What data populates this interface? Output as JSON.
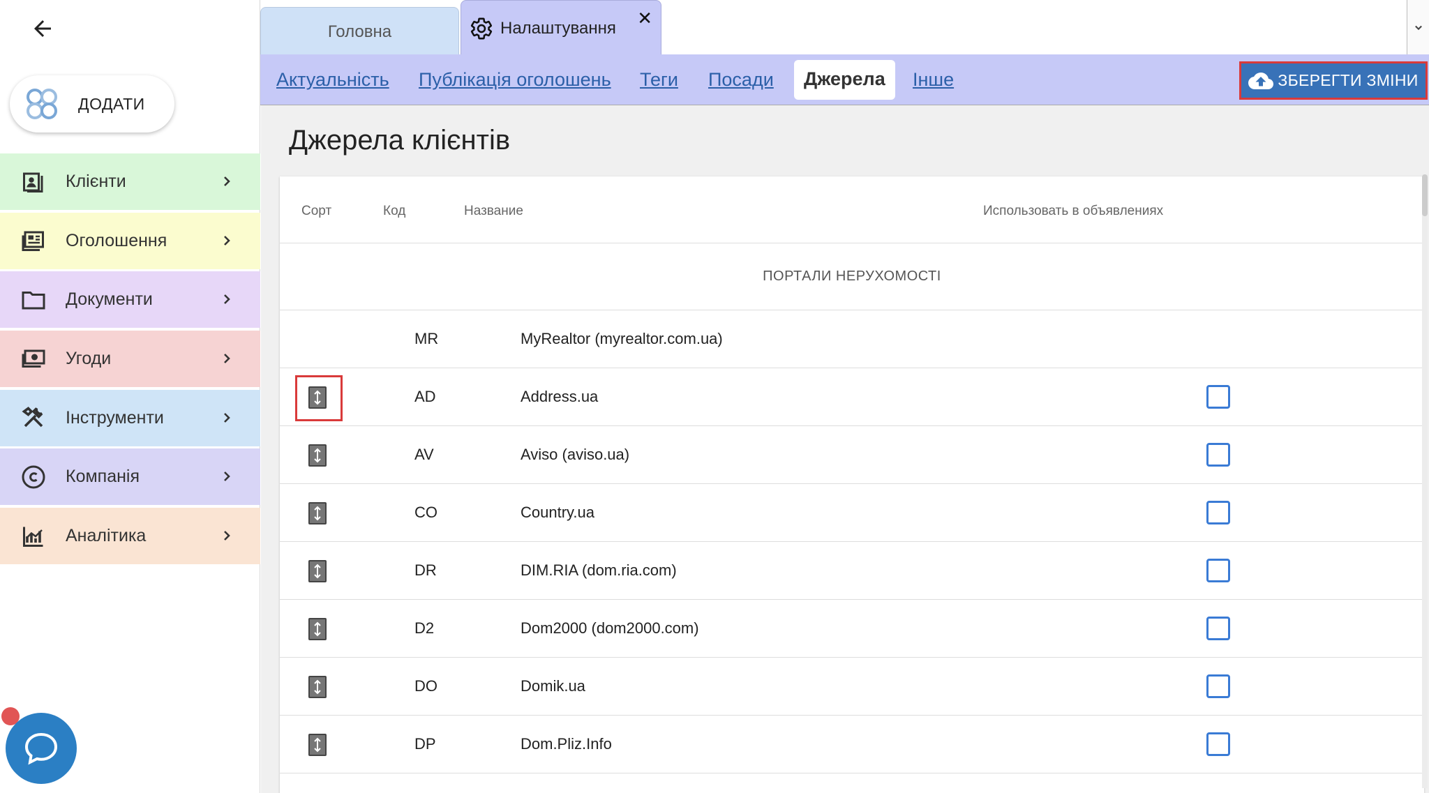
{
  "sidebar": {
    "add_label": "ДОДАТИ",
    "items": [
      {
        "label": "Клієнти",
        "icon": "contact-card-icon",
        "color": "#d9f7d9"
      },
      {
        "label": "Оголошення",
        "icon": "newspaper-icon",
        "color": "#fbfccf"
      },
      {
        "label": "Документи",
        "icon": "folder-icon",
        "color": "#e7d7f8"
      },
      {
        "label": "Угоди",
        "icon": "money-icon",
        "color": "#f6d3d3"
      },
      {
        "label": "Інструменти",
        "icon": "tools-icon",
        "color": "#cfe4f7"
      },
      {
        "label": "Компанія",
        "icon": "copyright-icon",
        "color": "#d8d5f6"
      },
      {
        "label": "Аналітика",
        "icon": "analytics-icon",
        "color": "#fae4d3"
      }
    ]
  },
  "tabs": {
    "home": "Головна",
    "settings": "Налаштування"
  },
  "subnav": {
    "items": [
      "Актуальність",
      "Публікація оголошень",
      "Теги",
      "Посади",
      "Джерела",
      "Інше"
    ],
    "active": "Джерела",
    "save_label": "ЗБЕРЕГТИ ЗМІНИ"
  },
  "page": {
    "title": "Джерела клієнтів"
  },
  "table": {
    "headers": {
      "sort": "Сорт",
      "code": "Код",
      "name": "Название",
      "use": "Использовать в объявлениях"
    },
    "group": "ПОРТАЛИ НЕРУХОМОСТІ",
    "rows": [
      {
        "code": "MR",
        "name": "MyRealtor (myrealtor.com.ua)",
        "sortable": false,
        "has_checkbox": false
      },
      {
        "code": "AD",
        "name": "Address.ua",
        "sortable": true,
        "has_checkbox": true
      },
      {
        "code": "AV",
        "name": "Aviso (aviso.ua)",
        "sortable": true,
        "has_checkbox": true
      },
      {
        "code": "CO",
        "name": "Country.ua",
        "sortable": true,
        "has_checkbox": true
      },
      {
        "code": "DR",
        "name": "DIM.RIA (dom.ria.com)",
        "sortable": true,
        "has_checkbox": true
      },
      {
        "code": "D2",
        "name": "Dom2000 (dom2000.com)",
        "sortable": true,
        "has_checkbox": true
      },
      {
        "code": "DO",
        "name": "Domik.ua",
        "sortable": true,
        "has_checkbox": true
      },
      {
        "code": "DP",
        "name": "Dom.Pliz.Info",
        "sortable": true,
        "has_checkbox": true
      }
    ]
  },
  "colors": {
    "accent": "#3872b8",
    "tab_active": "#c6c9f7",
    "highlight": "#d93a3a",
    "checkbox": "#3a7bd5"
  }
}
